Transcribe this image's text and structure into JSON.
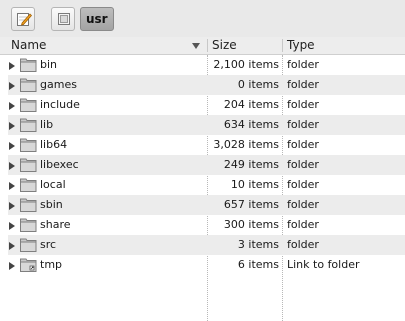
{
  "toolbar": {
    "edit_icon": "pencil-note-icon",
    "view_icon": "window-icon",
    "breadcrumb": "usr"
  },
  "columns": {
    "name": "Name",
    "size": "Size",
    "type": "Type",
    "sort_icon": "sort-down-icon"
  },
  "rows": [
    {
      "name": "bin",
      "size": "2,100 items",
      "type": "folder",
      "icon": "folder-icon"
    },
    {
      "name": "games",
      "size": "0 items",
      "type": "folder",
      "icon": "folder-icon"
    },
    {
      "name": "include",
      "size": "204 items",
      "type": "folder",
      "icon": "folder-icon"
    },
    {
      "name": "lib",
      "size": "634 items",
      "type": "folder",
      "icon": "folder-icon"
    },
    {
      "name": "lib64",
      "size": "3,028 items",
      "type": "folder",
      "icon": "folder-icon"
    },
    {
      "name": "libexec",
      "size": "249 items",
      "type": "folder",
      "icon": "folder-icon"
    },
    {
      "name": "local",
      "size": "10 items",
      "type": "folder",
      "icon": "folder-icon"
    },
    {
      "name": "sbin",
      "size": "657 items",
      "type": "folder",
      "icon": "folder-icon"
    },
    {
      "name": "share",
      "size": "300 items",
      "type": "folder",
      "icon": "folder-icon"
    },
    {
      "name": "src",
      "size": "3 items",
      "type": "folder",
      "icon": "folder-icon"
    },
    {
      "name": "tmp",
      "size": "6 items",
      "type": "Link to folder",
      "icon": "folder-link-icon"
    }
  ],
  "colors": {
    "toolbar_bg": "#e9e9e9",
    "row_alt": "#ececec",
    "crumb_bg": "#ababab"
  }
}
